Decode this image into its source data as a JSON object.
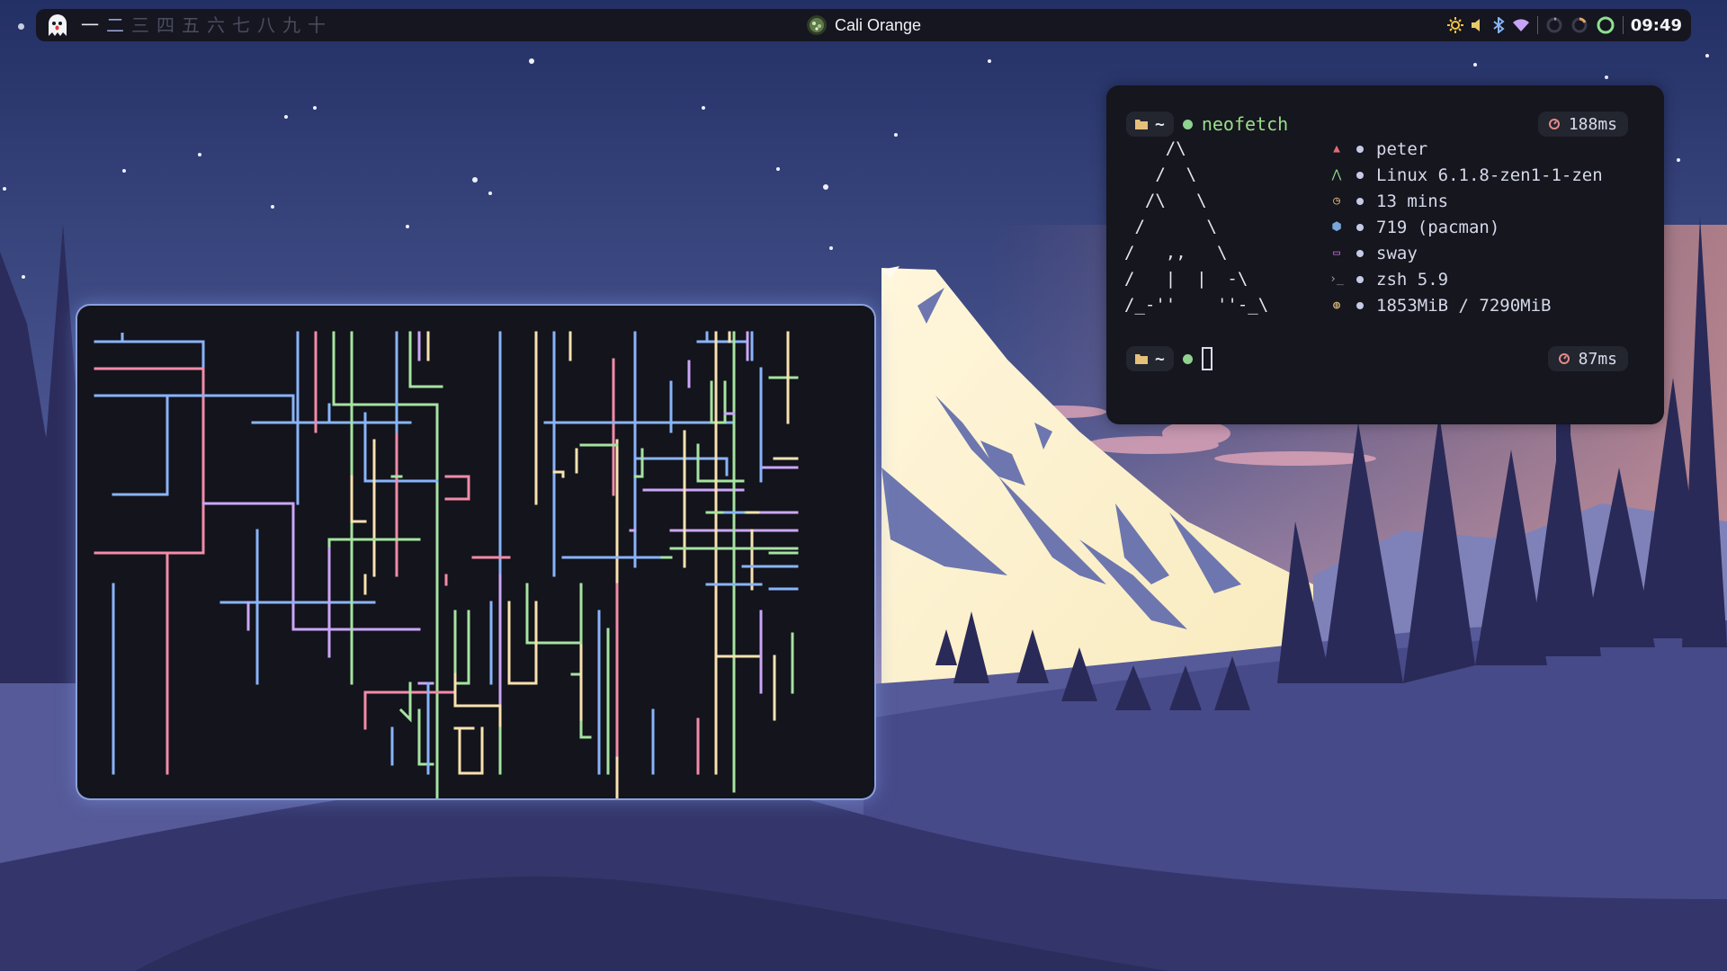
{
  "topbar": {
    "workspaces": [
      "一",
      "二",
      "三",
      "四",
      "五",
      "六",
      "七",
      "八",
      "九",
      "十"
    ],
    "active_workspace": "一",
    "occupied_workspace": "二",
    "window_title": "Cali Orange",
    "tray_icons": [
      "brightness-icon",
      "volume-icon",
      "bluetooth-icon",
      "wifi-icon",
      "cpu-ring-icon",
      "memory-ring-icon",
      "battery-ring-icon"
    ],
    "clock": "09:49"
  },
  "neofetch": {
    "command": "neofetch",
    "timing_1": "188ms",
    "timing_2": "87ms",
    "ascii_art": "    /\\\n   /  \\\n  /\\   \\\n /      \\\n/   ,,   \\\n/   |  |  -\\\n/_-''    ''-_\\",
    "info": [
      {
        "icon": "user-icon",
        "value": "peter",
        "color": "#e06c75"
      },
      {
        "icon": "arch-icon",
        "value": "Linux 6.1.8-zen1-1-zen",
        "color": "#98d98e"
      },
      {
        "icon": "uptime-icon",
        "value": "13 mins",
        "color": "#e5c07b"
      },
      {
        "icon": "package-icon",
        "value": "719 (pacman)",
        "color": "#7aa6da"
      },
      {
        "icon": "window-manager-icon",
        "value": "sway",
        "color": "#c678dd"
      },
      {
        "icon": "shell-icon",
        "value": "zsh 5.9",
        "color": "#9aa0b8"
      },
      {
        "icon": "memory-icon",
        "value": "1853MiB / 7290MiB",
        "color": "#e5c07b"
      }
    ]
  },
  "colors": {
    "pipe_blue": "#89b4fa",
    "pipe_red": "#f38ba8",
    "pipe_green": "#a6e3a1",
    "pipe_yellow": "#f9e2af",
    "pipe_purple": "#cba6f7",
    "pipe_cyan": "#94e2d5"
  }
}
